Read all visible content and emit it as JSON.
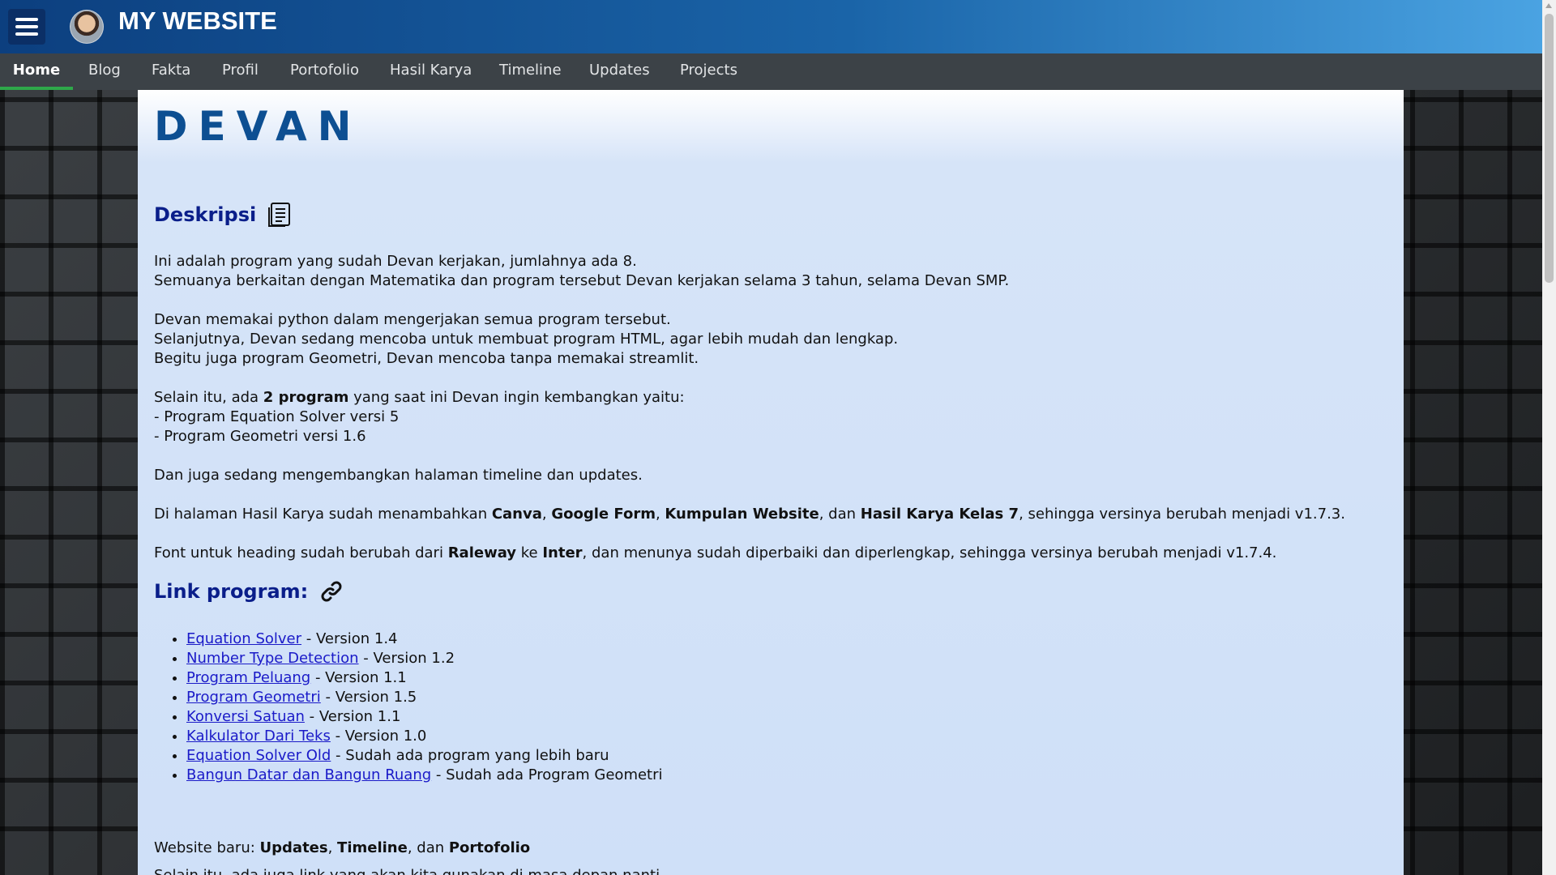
{
  "header": {
    "site_title": "MY WEBSITE"
  },
  "nav": [
    {
      "label": "Home"
    },
    {
      "label": "Blog"
    },
    {
      "label": "Fakta"
    },
    {
      "label": "Profil"
    },
    {
      "label": "Portofolio"
    },
    {
      "label": "Hasil Karya"
    },
    {
      "label": "Timeline"
    },
    {
      "label": "Updates"
    },
    {
      "label": "Projects"
    }
  ],
  "main": {
    "name": "DEVAN",
    "desc_title": "Deskripsi",
    "p1": {
      "a": "Ini adalah program yang sudah Devan kerjakan, jumlahnya ada 8.",
      "b": "Semuanya berkaitan dengan Matematika dan program tersebut Devan kerjakan selama 3 tahun, selama Devan SMP."
    },
    "p2": {
      "a": "Devan memakai python dalam mengerjakan semua program tersebut.",
      "b": "Selanjutnya, Devan sedang mencoba untuk membuat program HTML, agar lebih mudah dan lengkap.",
      "c": "Begitu juga program Geometri, Devan mencoba tanpa memakai streamlit."
    },
    "p3": {
      "pre": "Selain itu, ada ",
      "bold": "2 program",
      "post": " yang saat ini Devan ingin kembangkan yaitu:",
      "item1": "- Program Equation Solver versi 5",
      "item2": "- Program Geometri versi 1.6"
    },
    "p4": "Dan juga sedang mengembangkan halaman timeline dan updates.",
    "p5": {
      "pre": "Di halaman Hasil Karya sudah menambahkan ",
      "b1": "Canva",
      "s1": ", ",
      "b2": "Google Form",
      "s2": ", ",
      "b3": "Kumpulan Website",
      "s3": ", dan ",
      "b4": "Hasil Karya Kelas 7",
      "post": ", sehingga versinya berubah menjadi v1.7.3."
    },
    "p6": {
      "pre": "Font untuk heading sudah berubah dari ",
      "b1": "Raleway",
      "mid": " ke ",
      "b2": "Inter",
      "post": ", dan menunya sudah diperbaiki dan diperlengkap, sehingga versinya berubah menjadi v1.7.4."
    },
    "link_title": "Link program:",
    "links": [
      {
        "text": "Equation Solver",
        "note": " - Version 1.4"
      },
      {
        "text": "Number Type Detection",
        "note": " - Version 1.2"
      },
      {
        "text": "Program Peluang",
        "note": " - Version 1.1"
      },
      {
        "text": "Program Geometri",
        "note": " - Version 1.5"
      },
      {
        "text": "Konversi Satuan",
        "note": " - Version 1.1"
      },
      {
        "text": "Kalkulator Dari Teks",
        "note": " - Version 1.0"
      },
      {
        "text": "Equation Solver Old",
        "note": " - Sudah ada program yang lebih baru"
      },
      {
        "text": "Bangun Datar dan Bangun Ruang",
        "note": " - Sudah ada Program Geometri"
      }
    ],
    "new_site": {
      "pre": "Website baru: ",
      "b1": "Updates",
      "s1": ", ",
      "b2": "Timeline",
      "s2": ", dan ",
      "b3": "Portofolio"
    },
    "cut_line": "Selain itu, ada juga link yang akan kita gunakan di masa depan nanti"
  }
}
